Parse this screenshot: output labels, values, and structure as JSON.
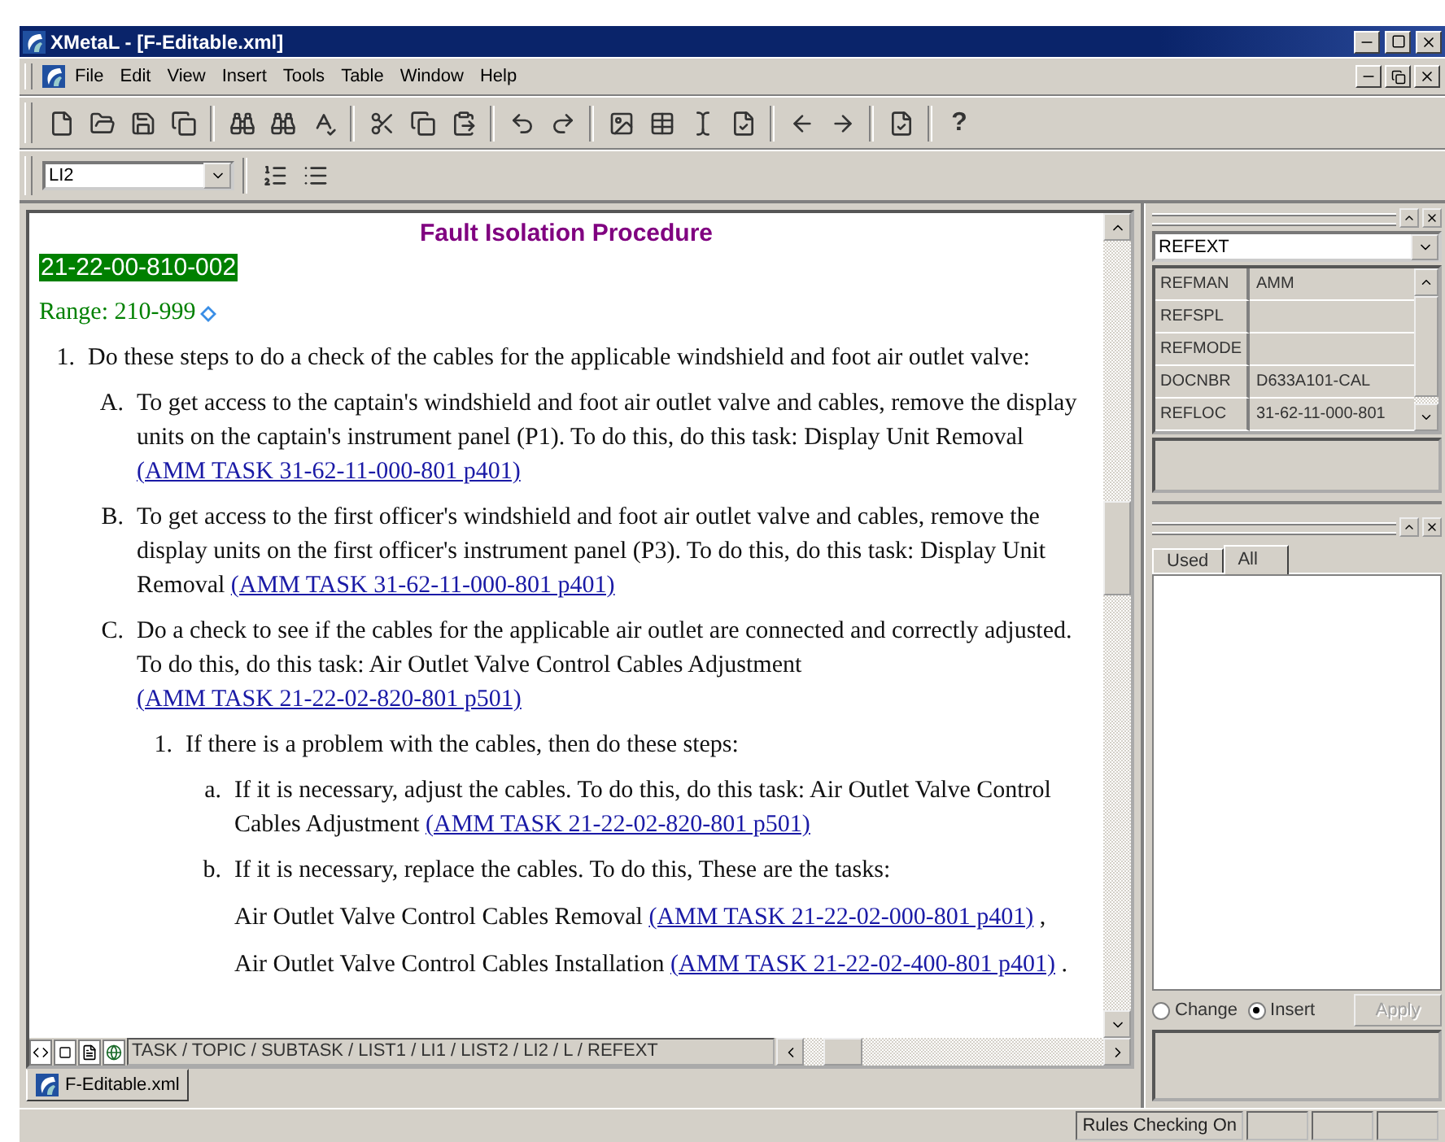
{
  "window": {
    "title": "XMetaL - [F-Editable.xml]"
  },
  "menu": [
    "File",
    "Edit",
    "View",
    "Insert",
    "Tools",
    "Table",
    "Window",
    "Help"
  ],
  "toolbar": {
    "help_label": "?"
  },
  "element_selector": {
    "value": "LI2"
  },
  "document": {
    "heading": "Fault Isolation Procedure",
    "id": "21-22-00-810-002",
    "range": "Range: 210-999",
    "list": [
      {
        "marker": "1.",
        "text": "Do these steps to do a check of the cables for the applicable windshield and foot air outlet valve:",
        "children": [
          {
            "marker": "A.",
            "text": "To get access to the captain's windshield and foot air outlet valve and cables, remove the display units on the captain's instrument panel (P1). To do this, do this task: Display Unit Removal",
            "link": "(AMM TASK 31-62-11-000-801 p401)"
          },
          {
            "marker": "B.",
            "text": "To get access to the first officer's windshield and foot air outlet valve and cables, remove the display units on the first officer's instrument panel (P3). To do this, do this task: Display Unit Removal",
            "link": "(AMM TASK 31-62-11-000-801 p401)"
          },
          {
            "marker": "C.",
            "text": "Do a check to see if the cables for the applicable air outlet are connected and correctly adjusted. To do this, do this task: Air Outlet Valve Control Cables Adjustment",
            "link": "(AMM TASK 21-22-02-820-801 p501)",
            "children": [
              {
                "marker": "1.",
                "text": "If there is a problem with the cables, then do these steps:",
                "children": [
                  {
                    "marker": "a.",
                    "text": "If it is necessary, adjust the cables. To do this, do this task: Air Outlet Valve Control Cables Adjustment",
                    "link": "(AMM TASK 21-22-02-820-801 p501)"
                  },
                  {
                    "marker": "b.",
                    "text": "If it is necessary, replace the cables. To do this, These are the tasks:",
                    "paragraphs": [
                      {
                        "text": "Air Outlet Valve Control Cables Removal",
                        "link": "(AMM TASK 21-22-02-000-801 p401)",
                        "after": ","
                      },
                      {
                        "text": "Air Outlet Valve Control Cables Installation",
                        "link": "(AMM TASK 21-22-02-400-801 p401)",
                        "after": "."
                      }
                    ]
                  }
                ]
              }
            ]
          }
        ]
      }
    ]
  },
  "breadcrumb": "TASK / TOPIC / SUBTASK / LIST1 / LI1 / LIST2 / LI2 / L / REFEXT",
  "document_tabs": [
    {
      "label": "F-Editable.xml",
      "selected": true
    }
  ],
  "attributes": {
    "element": "REFEXT",
    "rows": [
      {
        "name": "REFMAN",
        "value": "AMM"
      },
      {
        "name": "REFSPL",
        "value": ""
      },
      {
        "name": "REFMODE",
        "value": ""
      },
      {
        "name": "DOCNBR",
        "value": "D633A101-CAL"
      },
      {
        "name": "REFLOC",
        "value": "31-62-11-000-801"
      }
    ]
  },
  "resources": {
    "tabs": [
      {
        "label": "Used",
        "selected": false
      },
      {
        "label": "All",
        "selected": true
      }
    ],
    "modes": [
      {
        "label": "Change",
        "selected": false
      },
      {
        "label": "Insert",
        "selected": true
      }
    ],
    "apply": {
      "label": "Apply",
      "disabled": true
    }
  },
  "status_bar": {
    "text": "Rules Checking On"
  }
}
